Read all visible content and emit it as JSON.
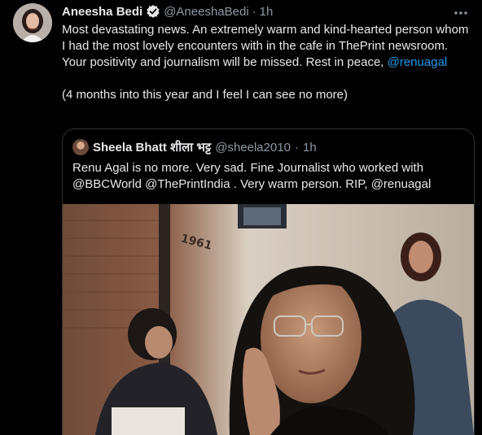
{
  "tweet": {
    "author_name": "Aneesha Bedi",
    "handle": "@AneeshaBedi",
    "separator": "·",
    "time": "1h",
    "more_icon": "ellipsis-icon",
    "verified_icon": "verified-badge-icon",
    "line1": "Most devastating news. An extremely warm and kind-hearted person whom I had the most lovely encounters with in the cafe in ThePrint newsroom.",
    "line2_prefix": "Your positivity and journalism will be missed. Rest in peace, ",
    "line2_mention": "@renuagal",
    "line3": "(4 months into this year and I feel I can see no more)"
  },
  "quote": {
    "author_name": "Sheela Bhatt शीला भट्ट",
    "handle": "@sheela2010",
    "separator": "·",
    "time": "1h",
    "line1": "Renu Agal is no more. Very sad. Fine Journalist who worked with",
    "line2": "@BBCWorld @ThePrintIndia . Very warm person. RIP, @renuagal",
    "photo_sign_text": "1961"
  },
  "colors": {
    "background": "#000000",
    "text": "#e7e9ea",
    "secondary": "#8b98a5",
    "link": "#1d9bf0",
    "border": "#2f3336"
  }
}
